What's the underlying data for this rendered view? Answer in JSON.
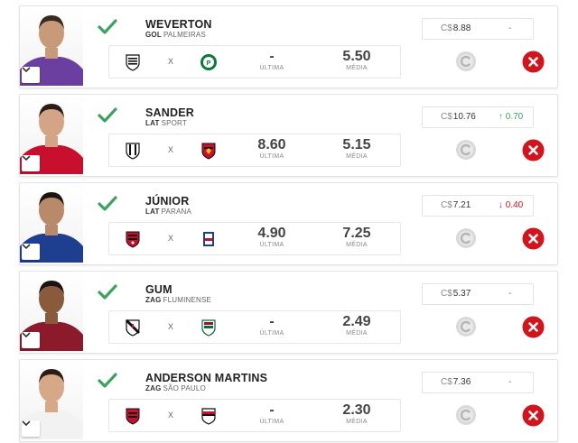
{
  "labels": {
    "vs": "X",
    "last": "Última",
    "avg": "Média",
    "currency": "C$"
  },
  "players": [
    {
      "name": "WEVERTON",
      "pos": "GOL",
      "team": "PALMEIRAS",
      "home_crest": "santos-crest-icon",
      "away_crest": "palmeiras-crest-icon",
      "last": "-",
      "avg": "5.50",
      "price": "8.88",
      "variation": "-",
      "variation_type": "neutral",
      "jersey_color": "#6b3fa0",
      "skin": "#c89a7a",
      "hair": "#3a2a20"
    },
    {
      "name": "SANDER",
      "pos": "LAT",
      "team": "SPORT",
      "home_crest": "ceara-crest-icon",
      "away_crest": "sport-crest-icon",
      "last": "8.60",
      "avg": "5.15",
      "price": "10.76",
      "variation": "↑ 0.70",
      "variation_type": "up",
      "jersey_color": "#c8102e",
      "skin": "#d3a486",
      "hair": "#2b1d16"
    },
    {
      "name": "JÚNIOR",
      "pos": "LAT",
      "team": "PARANA",
      "home_crest": "vitoria-crest-icon",
      "away_crest": "parana-crest-icon",
      "last": "4.90",
      "avg": "7.25",
      "price": "7.21",
      "variation": "↓ 0.40",
      "variation_type": "down",
      "jersey_color": "#1e3f8f",
      "skin": "#b98a6a",
      "hair": "#1a1410"
    },
    {
      "name": "GUM",
      "pos": "ZAG",
      "team": "FLUMINENSE",
      "home_crest": "vasco-crest-icon",
      "away_crest": "fluminense-crest-icon",
      "last": "-",
      "avg": "2.49",
      "price": "5.37",
      "variation": "-",
      "variation_type": "neutral",
      "jersey_color": "#8b1a2b",
      "skin": "#8a5a3c",
      "hair": "#1a1410"
    },
    {
      "name": "ANDERSON MARTINS",
      "pos": "ZAG",
      "team": "SÃO PAULO",
      "home_crest": "flamengo-crest-icon",
      "away_crest": "saopaulo-crest-icon",
      "last": "-",
      "avg": "2.30",
      "price": "7.36",
      "variation": "-",
      "variation_type": "neutral",
      "jersey_color": "#f2f2f2",
      "skin": "#d6a888",
      "hair": "#2b1d16"
    }
  ],
  "colors": {
    "check": "#3aa35c",
    "remove": "#d3141c",
    "coin": "#d9d9d9"
  }
}
